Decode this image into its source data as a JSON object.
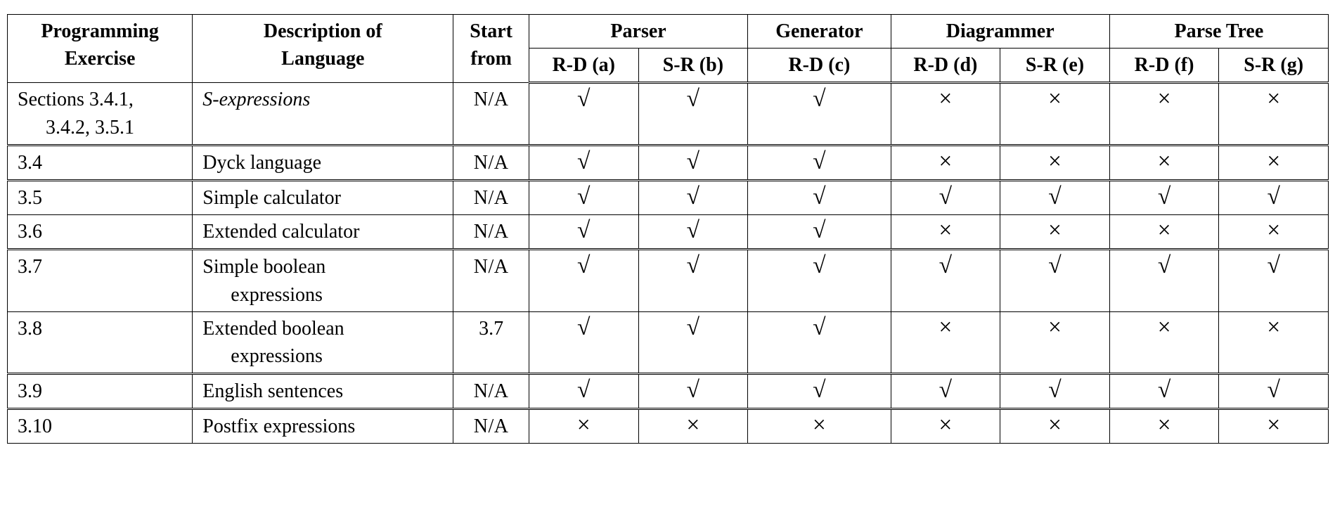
{
  "header": {
    "exercise": [
      "Programming",
      "Exercise"
    ],
    "language": [
      "Description of",
      "Language"
    ],
    "start": [
      "Start",
      "from"
    ],
    "parser": {
      "group": "Parser",
      "a": "R-D (a)",
      "b": "S-R (b)"
    },
    "generator": {
      "group": "Generator",
      "c": "R-D (c)"
    },
    "diagrammer": {
      "group": "Diagrammer",
      "d": "R-D (d)",
      "e": "S-R (e)"
    },
    "parsetree": {
      "group": "Parse Tree",
      "f": "R-D (f)",
      "g": "S-R (g)"
    }
  },
  "marks": {
    "check": "√",
    "cross": "×",
    "na": "N/A"
  },
  "rows": [
    {
      "exercise": "Sections 3.4.1,\n3.4.2, 3.5.1",
      "language": "S-expressions",
      "language_italic": true,
      "start": "na",
      "cells": [
        "check",
        "check",
        "check",
        "cross",
        "cross",
        "cross",
        "cross"
      ],
      "dbl_after": true
    },
    {
      "exercise": "3.4",
      "language": "Dyck language",
      "start": "na",
      "cells": [
        "check",
        "check",
        "check",
        "cross",
        "cross",
        "cross",
        "cross"
      ],
      "dbl_after": true
    },
    {
      "exercise": "3.5",
      "language": "Simple calculator",
      "start": "na",
      "cells": [
        "check",
        "check",
        "check",
        "check",
        "check",
        "check",
        "check"
      ]
    },
    {
      "exercise": "3.6",
      "language": "Extended calculator",
      "start": "na",
      "cells": [
        "check",
        "check",
        "check",
        "cross",
        "cross",
        "cross",
        "cross"
      ],
      "dbl_after": true
    },
    {
      "exercise": "3.7",
      "language": "Simple boolean\nexpressions",
      "start": "na",
      "cells": [
        "check",
        "check",
        "check",
        "check",
        "check",
        "check",
        "check"
      ]
    },
    {
      "exercise": "3.8",
      "language": "Extended boolean\nexpressions",
      "start": "3.7",
      "start_literal": true,
      "cells": [
        "check",
        "check",
        "check",
        "cross",
        "cross",
        "cross",
        "cross"
      ],
      "dbl_after": true
    },
    {
      "exercise": "3.9",
      "language": "English sentences",
      "start": "na",
      "cells": [
        "check",
        "check",
        "check",
        "check",
        "check",
        "check",
        "check"
      ],
      "dbl_after": true
    },
    {
      "exercise": "3.10",
      "language": "Postfix expressions",
      "start": "na",
      "cells": [
        "cross",
        "cross",
        "cross",
        "cross",
        "cross",
        "cross",
        "cross"
      ]
    }
  ]
}
